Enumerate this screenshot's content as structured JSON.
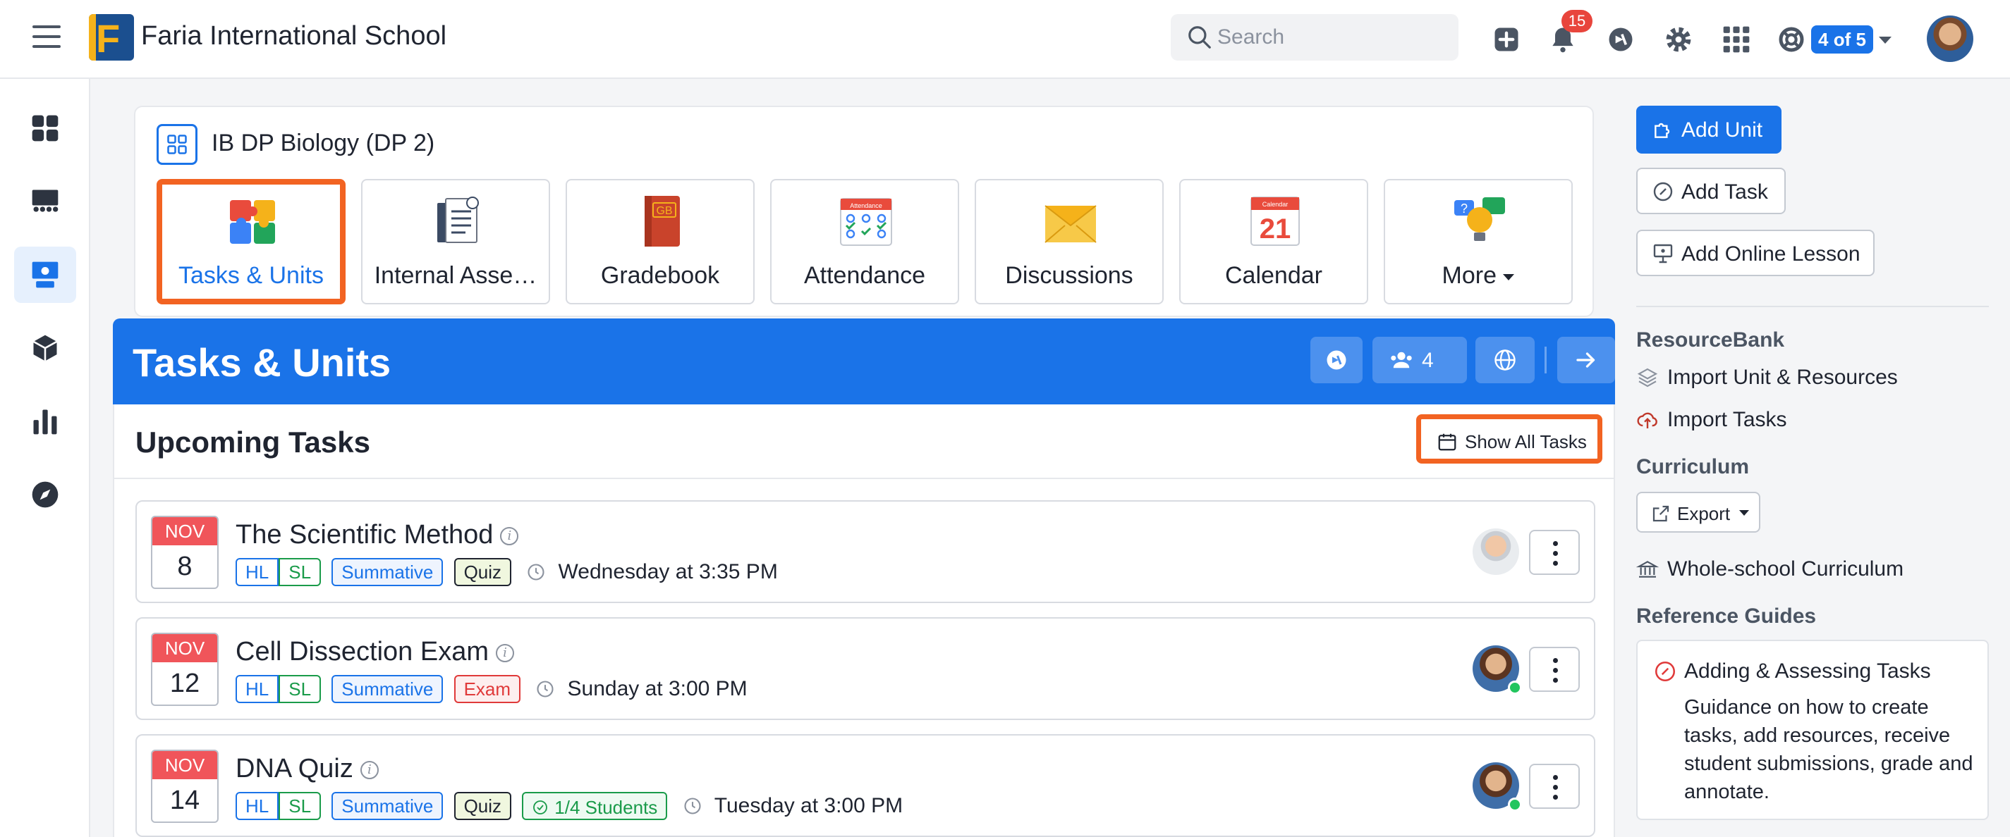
{
  "topbar": {
    "school_name": "Faria International School",
    "search_placeholder": "Search",
    "notifications_count": "15",
    "pager": "4 of 5"
  },
  "course": {
    "title": "IB DP Biology (DP 2)",
    "tiles": [
      {
        "label": "Tasks & Units",
        "icon": "puzzle-icon",
        "active": true
      },
      {
        "label": "Internal Asse…",
        "icon": "document-stack-icon"
      },
      {
        "label": "Gradebook",
        "icon": "gradebook-icon"
      },
      {
        "label": "Attendance",
        "icon": "attendance-calendar-icon"
      },
      {
        "label": "Discussions",
        "icon": "envelope-icon"
      },
      {
        "label": "Calendar",
        "icon": "calendar-icon"
      },
      {
        "label": "More",
        "icon": "lightbulb-chat-icon"
      }
    ],
    "gradebook_mark": "GB",
    "calendar_day": "21",
    "calendar_caption": "Calendar",
    "attendance_caption": "Attendance"
  },
  "band": {
    "title": "Tasks & Units",
    "members_count": "4"
  },
  "upcoming": {
    "title": "Upcoming Tasks",
    "show_all_label": "Show All Tasks",
    "tasks": [
      {
        "month": "NOV",
        "day": "8",
        "title": "The Scientific Method",
        "tags": [
          "HL",
          "SL",
          "Summative",
          "Quiz"
        ],
        "due": "Wednesday at 3:35 PM"
      },
      {
        "month": "NOV",
        "day": "12",
        "title": "Cell Dissection Exam",
        "tags": [
          "HL",
          "SL",
          "Summative",
          "Exam"
        ],
        "due": "Sunday at 3:00 PM"
      },
      {
        "month": "NOV",
        "day": "14",
        "title": "DNA Quiz",
        "tags": [
          "HL",
          "SL",
          "Summative",
          "Quiz",
          "1/4 Students"
        ],
        "due": "Tuesday at 3:00 PM"
      }
    ]
  },
  "right_panel": {
    "add_unit": "Add Unit",
    "add_task": "Add Task",
    "add_online_lesson": "Add Online Lesson",
    "resourcebank_heading": "ResourceBank",
    "import_unit": "Import Unit & Resources",
    "import_tasks": "Import Tasks",
    "curriculum_heading": "Curriculum",
    "export_label": "Export",
    "whole_school": "Whole-school Curriculum",
    "reference_heading": "Reference Guides",
    "guide_title": "Adding & Assessing Tasks",
    "guide_text": "Guidance on how to create tasks, add resources, receive student submissions, grade and annotate."
  },
  "colors": {
    "brand_blue": "#1a73e8",
    "highlight_orange": "#f26322",
    "date_red": "#f0555a"
  }
}
